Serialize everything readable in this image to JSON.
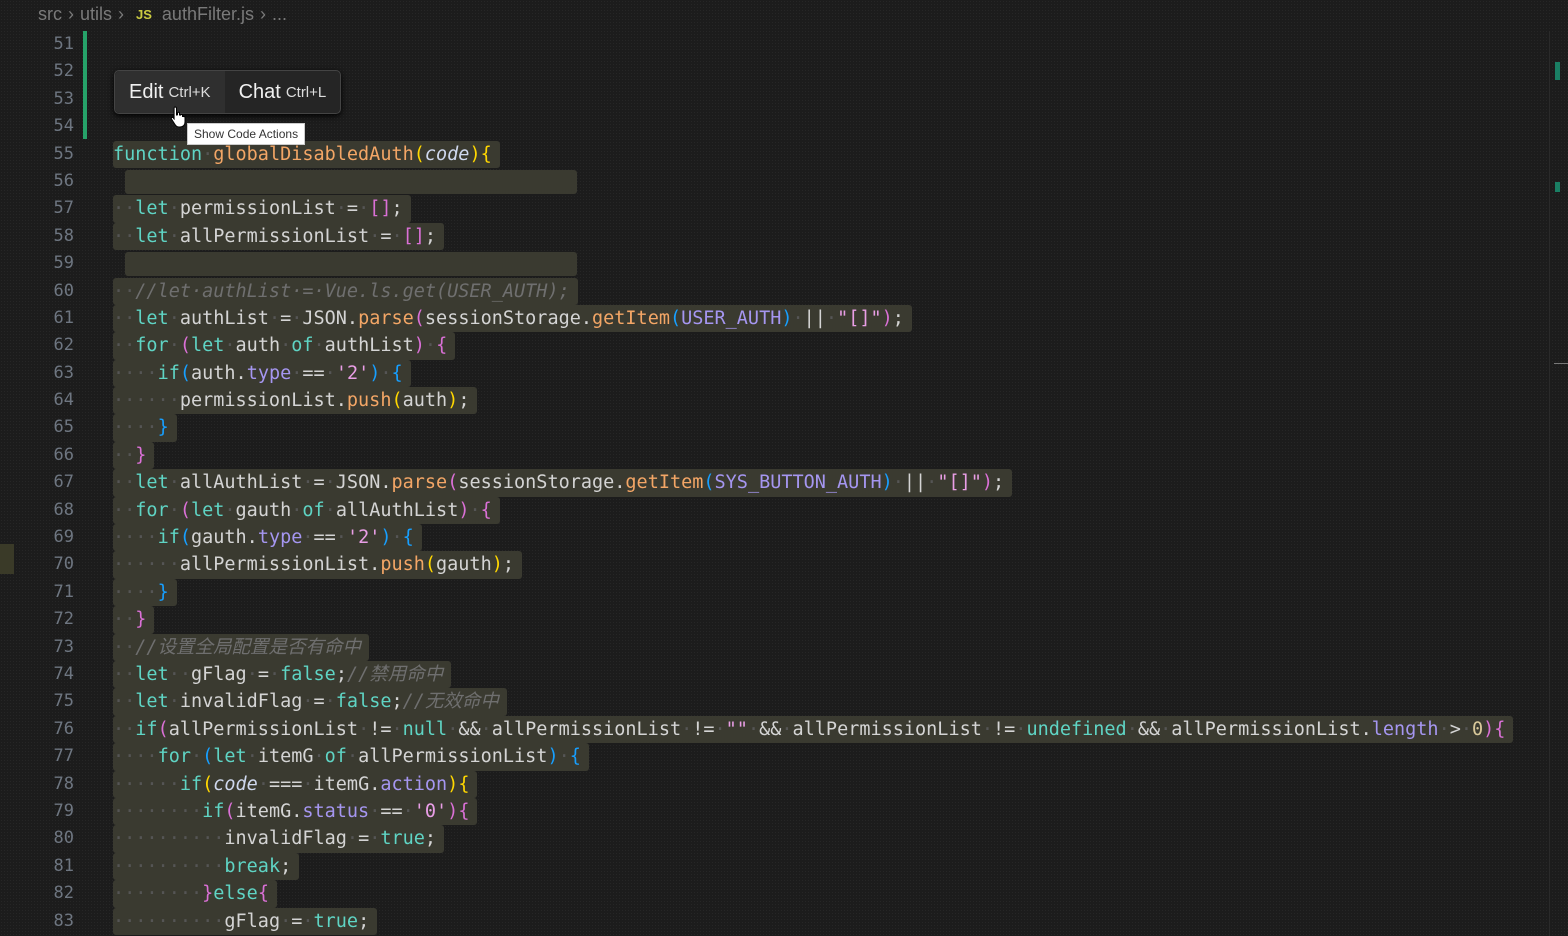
{
  "breadcrumb": {
    "items": [
      "src",
      "utils"
    ],
    "file_icon": "JS",
    "file": "authFilter.js",
    "more": "..."
  },
  "popup": {
    "edit_label": "Edit",
    "edit_shortcut": "Ctrl+K",
    "chat_label": "Chat",
    "chat_shortcut": "Ctrl+L"
  },
  "tooltip": "Show Code Actions",
  "first_line": 51,
  "lines": [
    [],
    [],
    [],
    [],
    [
      [
        "k",
        "function"
      ],
      [
        "ws",
        "·"
      ],
      [
        "f",
        "globalDisabledAuth"
      ],
      [
        "b1",
        "("
      ],
      [
        "par",
        "code"
      ],
      [
        "b1",
        ")"
      ],
      [
        "b1",
        "{"
      ]
    ],
    null,
    [
      [
        "ws",
        "··"
      ],
      [
        "k",
        "let"
      ],
      [
        "ws",
        "·"
      ],
      [
        "",
        "permissionList"
      ],
      [
        "ws",
        "·"
      ],
      [
        "",
        "="
      ],
      [
        "ws",
        "·"
      ],
      [
        "b2",
        "[]"
      ],
      [
        "",
        ";"
      ]
    ],
    [
      [
        "ws",
        "··"
      ],
      [
        "k",
        "let"
      ],
      [
        "ws",
        "·"
      ],
      [
        "",
        "allPermissionList"
      ],
      [
        "ws",
        "·"
      ],
      [
        "",
        "="
      ],
      [
        "ws",
        "·"
      ],
      [
        "b2",
        "[]"
      ],
      [
        "",
        ";"
      ]
    ],
    null,
    [
      [
        "ws",
        "··"
      ],
      [
        "c",
        "//let·authList·=·Vue.ls.get(USER_AUTH);"
      ]
    ],
    [
      [
        "ws",
        "··"
      ],
      [
        "k",
        "let"
      ],
      [
        "ws",
        "·"
      ],
      [
        "",
        "authList"
      ],
      [
        "ws",
        "·"
      ],
      [
        "",
        "="
      ],
      [
        "ws",
        "·"
      ],
      [
        "",
        "JSON."
      ],
      [
        "f",
        "parse"
      ],
      [
        "b2",
        "("
      ],
      [
        "",
        "sessionStorage."
      ],
      [
        "f",
        "getItem"
      ],
      [
        "b3",
        "("
      ],
      [
        "prop",
        "USER_AUTH"
      ],
      [
        "b3",
        ")"
      ],
      [
        "ws",
        "·"
      ],
      [
        "",
        "||"
      ],
      [
        "ws",
        "·"
      ],
      [
        "s",
        "\"[]\""
      ],
      [
        "b2",
        ")"
      ],
      [
        "",
        ";"
      ]
    ],
    [
      [
        "ws",
        "··"
      ],
      [
        "k",
        "for"
      ],
      [
        "ws",
        "·"
      ],
      [
        "b2",
        "("
      ],
      [
        "k",
        "let"
      ],
      [
        "ws",
        "·"
      ],
      [
        "",
        "auth"
      ],
      [
        "ws",
        "·"
      ],
      [
        "k",
        "of"
      ],
      [
        "ws",
        "·"
      ],
      [
        "",
        "authList"
      ],
      [
        "b2",
        ")"
      ],
      [
        "ws",
        "·"
      ],
      [
        "b2",
        "{"
      ]
    ],
    [
      [
        "ws",
        "····"
      ],
      [
        "k",
        "if"
      ],
      [
        "b3",
        "("
      ],
      [
        "",
        "auth."
      ],
      [
        "prop",
        "type"
      ],
      [
        "ws",
        "·"
      ],
      [
        "",
        "=="
      ],
      [
        "ws",
        "·"
      ],
      [
        "s",
        "'2'"
      ],
      [
        "b3",
        ")"
      ],
      [
        "ws",
        "·"
      ],
      [
        "b3",
        "{"
      ]
    ],
    [
      [
        "ws",
        "······"
      ],
      [
        "",
        "permissionList."
      ],
      [
        "f",
        "push"
      ],
      [
        "b1",
        "("
      ],
      [
        "",
        "auth"
      ],
      [
        "b1",
        ")"
      ],
      [
        "",
        ";"
      ]
    ],
    [
      [
        "ws",
        "····"
      ],
      [
        "b3",
        "}"
      ]
    ],
    [
      [
        "ws",
        "··"
      ],
      [
        "b2",
        "}"
      ]
    ],
    [
      [
        "ws",
        "··"
      ],
      [
        "k",
        "let"
      ],
      [
        "ws",
        "·"
      ],
      [
        "",
        "allAuthList"
      ],
      [
        "ws",
        "·"
      ],
      [
        "",
        "="
      ],
      [
        "ws",
        "·"
      ],
      [
        "",
        "JSON."
      ],
      [
        "f",
        "parse"
      ],
      [
        "b2",
        "("
      ],
      [
        "",
        "sessionStorage."
      ],
      [
        "f",
        "getItem"
      ],
      [
        "b3",
        "("
      ],
      [
        "prop",
        "SYS_BUTTON_AUTH"
      ],
      [
        "b3",
        ")"
      ],
      [
        "ws",
        "·"
      ],
      [
        "",
        "||"
      ],
      [
        "ws",
        "·"
      ],
      [
        "s",
        "\"[]\""
      ],
      [
        "b2",
        ")"
      ],
      [
        "",
        ";"
      ]
    ],
    [
      [
        "ws",
        "··"
      ],
      [
        "k",
        "for"
      ],
      [
        "ws",
        "·"
      ],
      [
        "b2",
        "("
      ],
      [
        "k",
        "let"
      ],
      [
        "ws",
        "·"
      ],
      [
        "",
        "gauth"
      ],
      [
        "ws",
        "·"
      ],
      [
        "k",
        "of"
      ],
      [
        "ws",
        "·"
      ],
      [
        "",
        "allAuthList"
      ],
      [
        "b2",
        ")"
      ],
      [
        "ws",
        "·"
      ],
      [
        "b2",
        "{"
      ]
    ],
    [
      [
        "ws",
        "····"
      ],
      [
        "k",
        "if"
      ],
      [
        "b3",
        "("
      ],
      [
        "",
        "gauth."
      ],
      [
        "prop",
        "type"
      ],
      [
        "ws",
        "·"
      ],
      [
        "",
        "=="
      ],
      [
        "ws",
        "·"
      ],
      [
        "s",
        "'2'"
      ],
      [
        "b3",
        ")"
      ],
      [
        "ws",
        "·"
      ],
      [
        "b3",
        "{"
      ]
    ],
    [
      [
        "ws",
        "······"
      ],
      [
        "",
        "allPermissionList."
      ],
      [
        "f",
        "push"
      ],
      [
        "b1",
        "("
      ],
      [
        "",
        "gauth"
      ],
      [
        "b1",
        ")"
      ],
      [
        "",
        ";"
      ]
    ],
    [
      [
        "ws",
        "····"
      ],
      [
        "b3",
        "}"
      ]
    ],
    [
      [
        "ws",
        "··"
      ],
      [
        "b2",
        "}"
      ]
    ],
    [
      [
        "ws",
        "··"
      ],
      [
        "c",
        "//设置全局配置是否有命中"
      ]
    ],
    [
      [
        "ws",
        "··"
      ],
      [
        "k",
        "let"
      ],
      [
        "ws",
        "··"
      ],
      [
        "",
        "gFlag"
      ],
      [
        "ws",
        "·"
      ],
      [
        "",
        "="
      ],
      [
        "ws",
        "·"
      ],
      [
        "k",
        "false"
      ],
      [
        "",
        ";"
      ],
      [
        "c",
        "//禁用命中"
      ]
    ],
    [
      [
        "ws",
        "··"
      ],
      [
        "k",
        "let"
      ],
      [
        "ws",
        "·"
      ],
      [
        "",
        "invalidFlag"
      ],
      [
        "ws",
        "·"
      ],
      [
        "",
        "="
      ],
      [
        "ws",
        "·"
      ],
      [
        "k",
        "false"
      ],
      [
        "",
        ";"
      ],
      [
        "c",
        "//无效命中"
      ]
    ],
    [
      [
        "ws",
        "··"
      ],
      [
        "k",
        "if"
      ],
      [
        "b2",
        "("
      ],
      [
        "",
        "allPermissionList"
      ],
      [
        "ws",
        "·"
      ],
      [
        "",
        "!="
      ],
      [
        "ws",
        "·"
      ],
      [
        "k",
        "null"
      ],
      [
        "ws",
        "·"
      ],
      [
        "",
        "&&"
      ],
      [
        "ws",
        "·"
      ],
      [
        "",
        "allPermissionList"
      ],
      [
        "ws",
        "·"
      ],
      [
        "",
        "!="
      ],
      [
        "ws",
        "·"
      ],
      [
        "s",
        "\"\""
      ],
      [
        "ws",
        "·"
      ],
      [
        "",
        "&&"
      ],
      [
        "ws",
        "·"
      ],
      [
        "",
        "allPermissionList"
      ],
      [
        "ws",
        "·"
      ],
      [
        "",
        "!="
      ],
      [
        "ws",
        "·"
      ],
      [
        "k",
        "undefined"
      ],
      [
        "ws",
        "·"
      ],
      [
        "",
        "&&"
      ],
      [
        "ws",
        "·"
      ],
      [
        "",
        "allPermissionList."
      ],
      [
        "prop",
        "length"
      ],
      [
        "ws",
        "·"
      ],
      [
        "",
        ">"
      ],
      [
        "ws",
        "·"
      ],
      [
        "n",
        "0"
      ],
      [
        "b2",
        ")"
      ],
      [
        "b2",
        "{"
      ]
    ],
    [
      [
        "ws",
        "····"
      ],
      [
        "k",
        "for"
      ],
      [
        "ws",
        "·"
      ],
      [
        "b3",
        "("
      ],
      [
        "k",
        "let"
      ],
      [
        "ws",
        "·"
      ],
      [
        "",
        "itemG"
      ],
      [
        "ws",
        "·"
      ],
      [
        "k",
        "of"
      ],
      [
        "ws",
        "·"
      ],
      [
        "",
        "allPermissionList"
      ],
      [
        "b3",
        ")"
      ],
      [
        "ws",
        "·"
      ],
      [
        "b3",
        "{"
      ]
    ],
    [
      [
        "ws",
        "······"
      ],
      [
        "k",
        "if"
      ],
      [
        "b1",
        "("
      ],
      [
        "par",
        "code"
      ],
      [
        "ws",
        "·"
      ],
      [
        "",
        "==="
      ],
      [
        "ws",
        "·"
      ],
      [
        "",
        "itemG."
      ],
      [
        "prop",
        "action"
      ],
      [
        "b1",
        ")"
      ],
      [
        "b1",
        "{"
      ]
    ],
    [
      [
        "ws",
        "········"
      ],
      [
        "k",
        "if"
      ],
      [
        "b2",
        "("
      ],
      [
        "",
        "itemG."
      ],
      [
        "prop",
        "status"
      ],
      [
        "ws",
        "·"
      ],
      [
        "",
        "=="
      ],
      [
        "ws",
        "·"
      ],
      [
        "s",
        "'0'"
      ],
      [
        "b2",
        ")"
      ],
      [
        "b2",
        "{"
      ]
    ],
    [
      [
        "ws",
        "··········"
      ],
      [
        "",
        "invalidFlag"
      ],
      [
        "ws",
        "·"
      ],
      [
        "",
        "="
      ],
      [
        "ws",
        "·"
      ],
      [
        "k",
        "true"
      ],
      [
        "",
        ";"
      ]
    ],
    [
      [
        "ws",
        "··········"
      ],
      [
        "k",
        "break"
      ],
      [
        "",
        ";"
      ]
    ],
    [
      [
        "ws",
        "········"
      ],
      [
        "b2",
        "}"
      ],
      [
        "k",
        "else"
      ],
      [
        "b2",
        "{"
      ]
    ],
    [
      [
        "ws",
        "··········"
      ],
      [
        "",
        "gFlag"
      ],
      [
        "ws",
        "·"
      ],
      [
        "",
        "="
      ],
      [
        "ws",
        "·"
      ],
      [
        "k",
        "true"
      ],
      [
        "",
        ";"
      ]
    ]
  ]
}
